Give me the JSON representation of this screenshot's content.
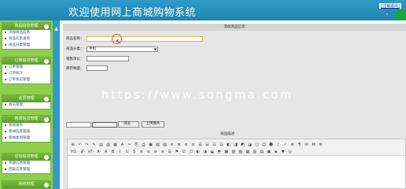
{
  "header": {
    "title": "欢迎使用网上商城购物系统",
    "logout_label": "[注销退出]",
    "settings_icon": "‹"
  },
  "sidebar": {
    "groups": [
      {
        "title": "商品信息管理",
        "items": [
          "添加商品信息",
          "商品信息查询",
          "商品分类管理"
        ]
      },
      {
        "title": "订单信息管理",
        "items": [
          "订单管理",
          "订单统计",
          "订单状态管理"
        ]
      },
      {
        "title": "会员管理",
        "items": [
          "会员管理"
        ]
      },
      {
        "title": "新闻信息管理",
        "items": [
          "新闻发布",
          "新闻信息管理",
          "新闻类别管理"
        ]
      },
      {
        "title": "论坛信息管理",
        "items": [
          "专题信息管理",
          "回复信息管理"
        ]
      },
      {
        "title": "系统管理",
        "items": []
      }
    ]
  },
  "main": {
    "panel_title": "添加商品信息",
    "fields": {
      "name_label": "商品名称：",
      "name_value": "",
      "category_label": "商品分类：",
      "category_value": "手机",
      "price_label": "销售单价：",
      "price_value": "",
      "stock_label": "库存数量：",
      "stock_value": ""
    },
    "watermark": "https://www.songma.com",
    "browse_label": "浏览...",
    "upload_label": "上传图片",
    "desc_label": "商品描述"
  },
  "editor": {
    "row1": [
      "⊞",
      "↶",
      "↷",
      "✎",
      "▤",
      "▥",
      "▦",
      "A",
      "✂",
      "⎘",
      "⎙",
      "▣",
      "▧",
      "▨",
      "≡",
      "≣",
      "≡",
      "≡",
      "☰",
      "☱",
      "☲",
      "☳",
      "◧",
      "◨",
      "◩",
      "◪",
      "◫",
      "☺",
      "☻",
      "♪",
      "✓",
      "⊗",
      "¶",
      "✉",
      "⌘",
      "⚙"
    ],
    "row2": [
      "H1·",
      "𝒯·",
      "sT·",
      "A·",
      "A",
      "B",
      "I",
      "U",
      "S",
      "≡",
      "≡",
      "≡",
      "≡",
      "☰",
      "⚑",
      "☑",
      "☐",
      "◐",
      "◑",
      "◒",
      "◓",
      "▩",
      "▨",
      "▧",
      "▦",
      "▥",
      "▤",
      "▣",
      "◈",
      "▼",
      "◎"
    ]
  }
}
